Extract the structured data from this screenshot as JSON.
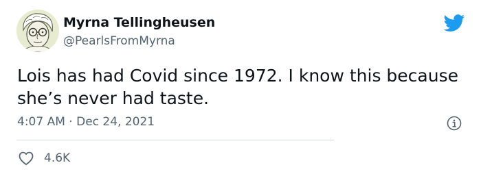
{
  "user": {
    "display_name": "Myrna Tellingheusen",
    "handle": "@PearlsFromMyrna"
  },
  "tweet": {
    "text": "Lois has had Covid since 1972. I know this because she’s never had taste.",
    "time": "4:07 AM",
    "separator": "·",
    "date": "Dec 24, 2021"
  },
  "stats": {
    "likes": "4.6K"
  },
  "icons": {
    "brand": "twitter-bird-icon",
    "info": "info-icon",
    "like": "heart-icon"
  },
  "colors": {
    "twitter_blue": "#1d9bf0",
    "secondary_text": "#536471",
    "primary_text": "#0f1419"
  }
}
